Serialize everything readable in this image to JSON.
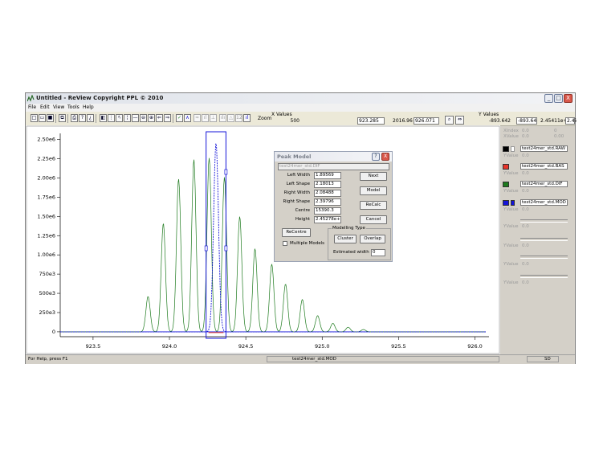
{
  "window": {
    "title": "Untitled - ReView Copyright PPL  © 2010",
    "controls": [
      "_",
      "□",
      "X"
    ]
  },
  "menu": [
    "File",
    "Edit",
    "View",
    "Tools",
    "Help"
  ],
  "toolbar": {
    "zoom_label": "Zoom",
    "x_values_label": "X Values",
    "x_min_label": "500",
    "x_min_value": "923.285",
    "x_max_label": "2016.96",
    "x_max_value": "926.071",
    "y_values_label": "Y Values",
    "y_min_label": "-893.642",
    "y_min_value": "-893.642",
    "y_max_label": "2.45411e+006",
    "y_max_value": "2.45"
  },
  "right_panel": {
    "xindex_label": "XIndex",
    "xindex_value": "0.0",
    "xindex_extra": "0",
    "xvalue_label": "XValue",
    "xvalue_value": "0.0",
    "xvalue_extra": "0.00",
    "series": [
      {
        "name": "test24mer_std.RAW",
        "color": "#000000"
      },
      {
        "name": "test24mer_std.BAS",
        "color": "#e8352a"
      },
      {
        "name": "test24mer_std.DIF",
        "color": "#1d7a1d"
      },
      {
        "name": "test24mer_std.MOD",
        "color": "#1414d8"
      }
    ],
    "yvalue_label": "YValue",
    "yvalue_value": "0.0"
  },
  "status": {
    "help": "For Help, press F1",
    "file": "test24mer_std.MOD",
    "mode": "SD"
  },
  "dialog": {
    "title": "Peak Model",
    "help_btn": "?",
    "close_btn": "X",
    "source": "test24mer_std.DIF",
    "fields": [
      {
        "label": "Left Width",
        "value": "1.89569"
      },
      {
        "label": "Left Shape",
        "value": "2.18013"
      },
      {
        "label": "Right Width",
        "value": "2.08488"
      },
      {
        "label": "Right Shape",
        "value": "2.39796"
      },
      {
        "label": "Centre",
        "value": "15390.3"
      },
      {
        "label": "Height",
        "value": "2.45278e+"
      }
    ],
    "buttons": [
      "Next",
      "Model",
      "ReCalc",
      "Cancel"
    ],
    "recentre": "ReCentre",
    "multiple_models": "Multiple Models",
    "modelling_type": "Modelling Type",
    "cluster": "Cluster",
    "overlap": "Overlap",
    "estimated_width_label": "Estimated width",
    "estimated_width_value": "0"
  },
  "chart_data": {
    "type": "line",
    "xlim": [
      923.285,
      926.071
    ],
    "ylim": [
      -893.642,
      2454110
    ],
    "x_ticks": [
      "923.5",
      "924.0",
      "924.5",
      "925.0",
      "925.5",
      "926.0"
    ],
    "x_tick_values": [
      923.5,
      924.0,
      924.5,
      925.0,
      925.5,
      926.0
    ],
    "y_ticks": [
      "2.50e6",
      "2.25e6",
      "2.00e6",
      "1.75e6",
      "1.50e6",
      "1.25e6",
      "1.00e6",
      "750e3",
      "500e3",
      "250e3",
      "0"
    ],
    "y_tick_values": [
      2500000,
      2250000,
      2000000,
      1750000,
      1500000,
      1250000,
      1000000,
      750000,
      500000,
      250000,
      0
    ],
    "series": [
      {
        "name": "test24mer_std.DIF",
        "color": "#1d7a1d",
        "peaks": [
          [
            923.86,
            460000
          ],
          [
            923.96,
            1410000
          ],
          [
            924.06,
            1990000
          ],
          [
            924.16,
            2240000
          ],
          [
            924.26,
            2260000
          ],
          [
            924.36,
            2010000
          ],
          [
            924.46,
            1500000
          ],
          [
            924.56,
            1080000
          ],
          [
            924.67,
            880000
          ],
          [
            924.76,
            620000
          ],
          [
            924.87,
            420000
          ],
          [
            924.97,
            210000
          ],
          [
            925.07,
            110000
          ],
          [
            925.17,
            60000
          ],
          [
            925.27,
            30000
          ]
        ]
      },
      {
        "name": "test24mer_std.MOD",
        "color": "#1414d8",
        "peaks": [
          [
            924.305,
            2452780
          ]
        ]
      }
    ],
    "selection_x": [
      924.24,
      924.37
    ]
  }
}
